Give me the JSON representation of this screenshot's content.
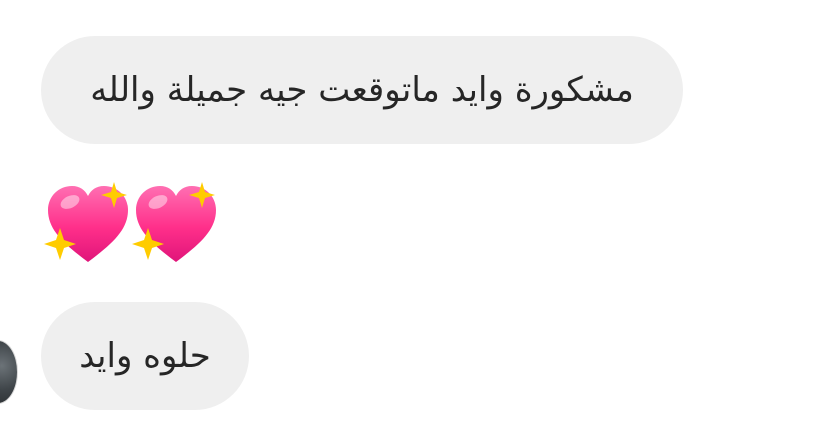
{
  "messages": [
    {
      "text": "مشكورة وايد ماتوقعت جيه جميلة والله"
    },
    {
      "emoji": "💖✨💖✨"
    },
    {
      "text": "حلوه وايد"
    }
  ],
  "colors": {
    "bubble_bg": "#efefef",
    "text": "#262626",
    "heart_main": "#ff2f8a",
    "sparkle": "#ffcc00"
  },
  "icons": {
    "heart_sparkle": "sparkling-heart-icon",
    "avatar": "avatar"
  }
}
